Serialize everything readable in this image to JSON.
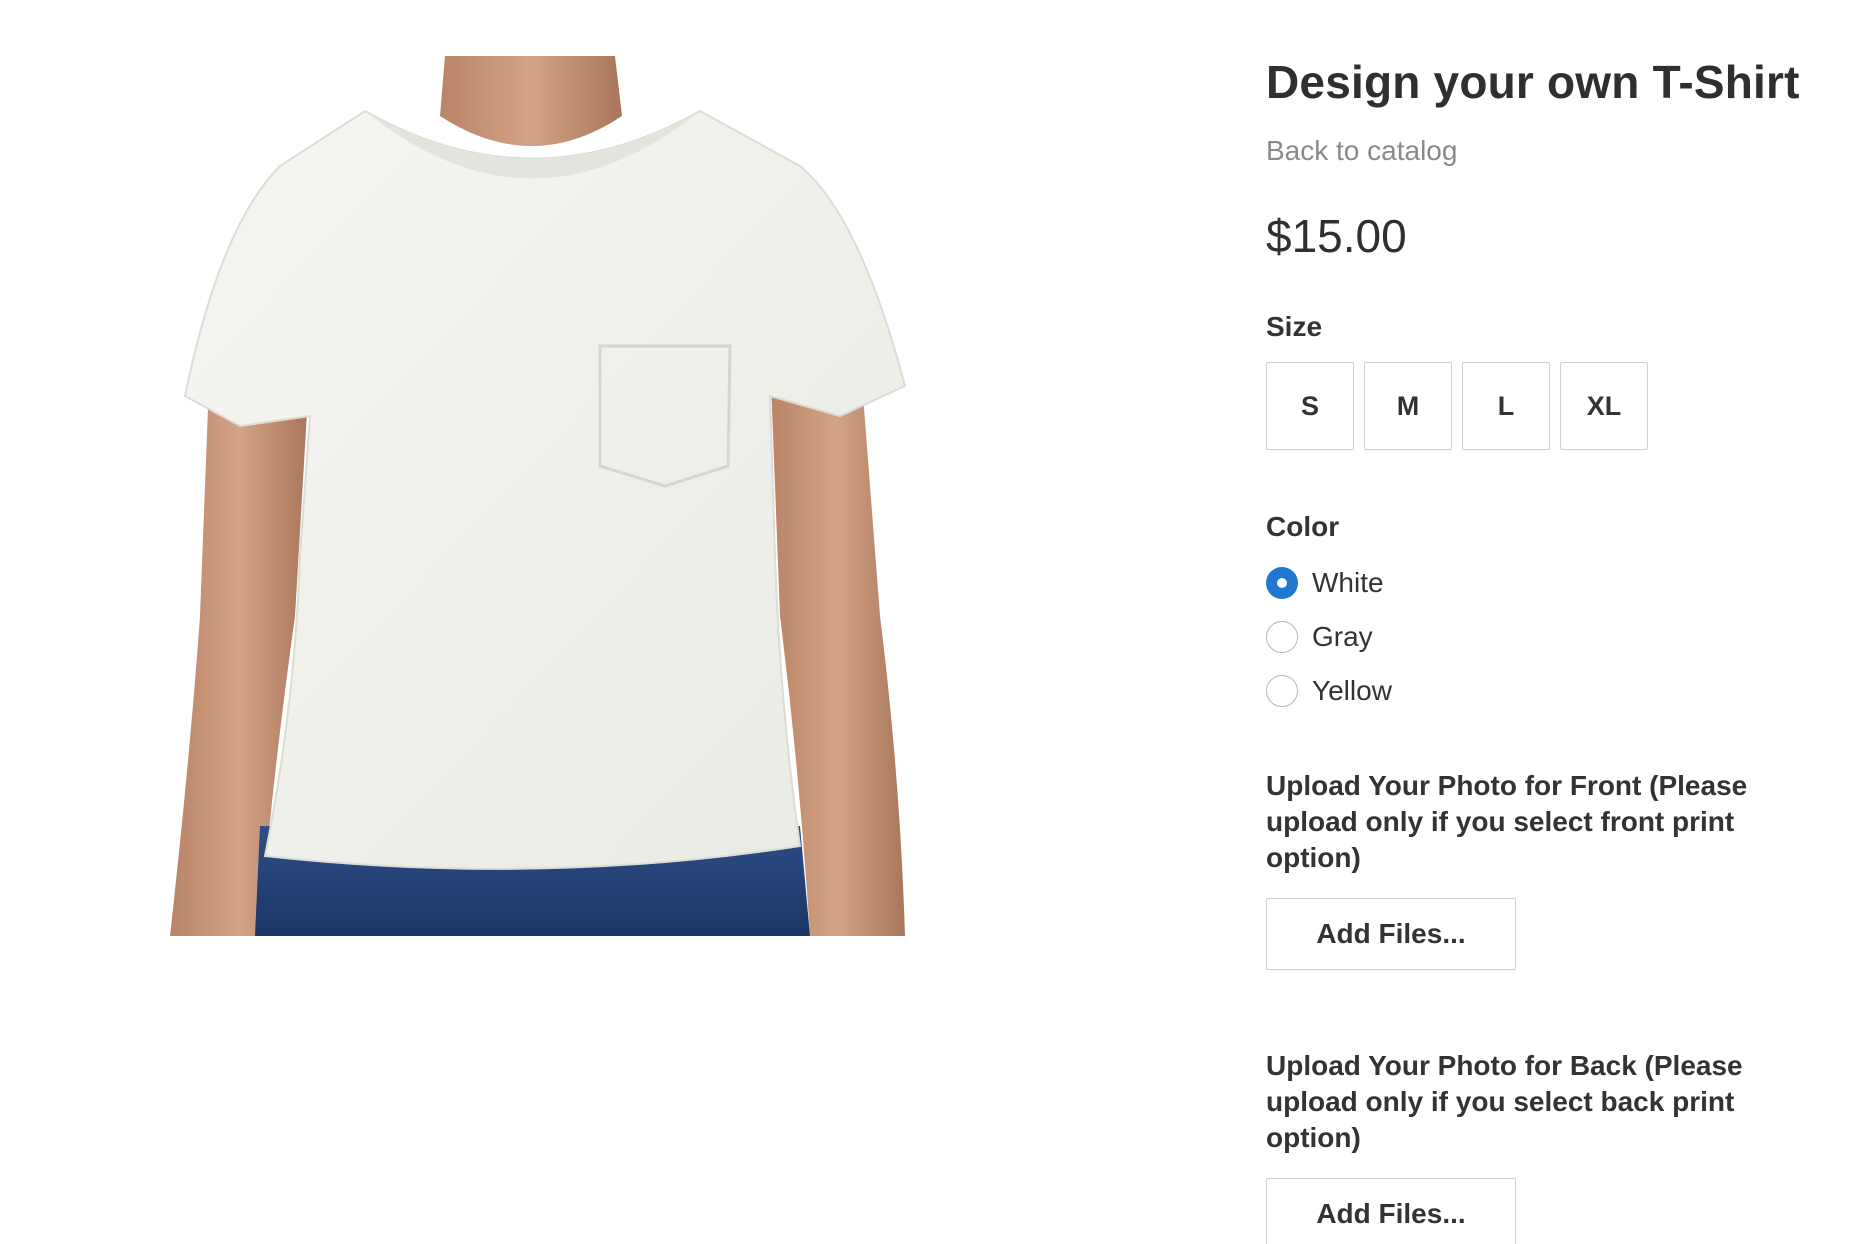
{
  "product": {
    "title": "Design your own T-Shirt",
    "back_link": "Back to catalog",
    "price": "$15.00",
    "image_icon": "t-shirt-photo"
  },
  "size": {
    "label": "Size",
    "options": [
      "S",
      "M",
      "L",
      "XL"
    ]
  },
  "color": {
    "label": "Color",
    "accent": "#1f77d0",
    "selected": "White",
    "options": [
      "White",
      "Gray",
      "Yellow"
    ]
  },
  "upload_front": {
    "label": "Upload Your Photo for Front (Please upload only if you select front print option)",
    "button": "Add Files..."
  },
  "upload_back": {
    "label": "Upload Your Photo for Back (Please upload only if you select back print option)",
    "button": "Add Files..."
  }
}
